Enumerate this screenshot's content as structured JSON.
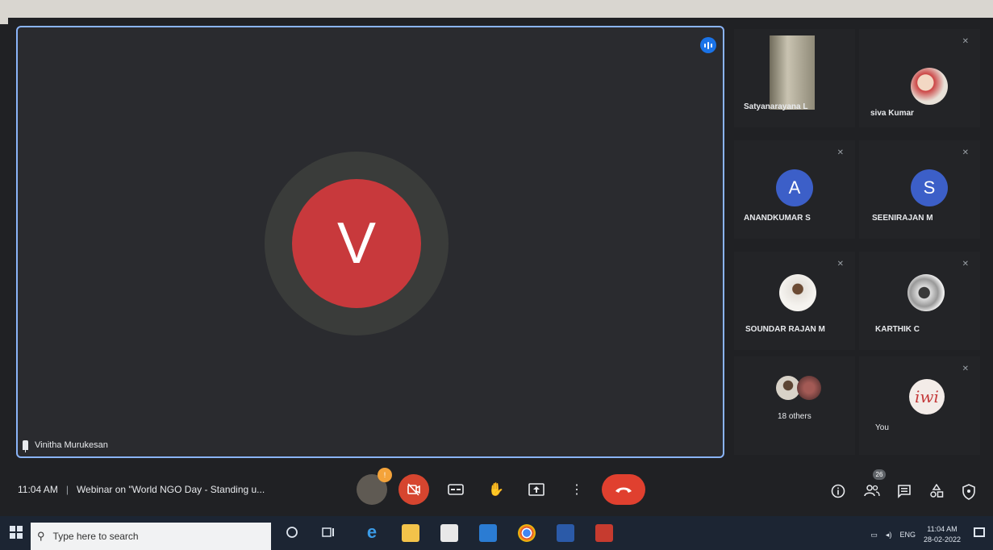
{
  "colors": {
    "accent_blue": "#8ab4f8",
    "avatar_v": "#c8393c",
    "avatar_letter": "#3c5fc8",
    "end_call": "#e0402f"
  },
  "main_speaker": {
    "initial": "V",
    "name": "Vinitha Murukesan"
  },
  "participants": [
    {
      "name": "Satyanarayana L",
      "avatar": "photo",
      "muted": false
    },
    {
      "name": "siva Kumar",
      "avatar": "photo",
      "muted": true
    },
    {
      "name": "ANANDKUMAR S",
      "avatar": "letter",
      "initial": "A",
      "muted": true
    },
    {
      "name": "SEENIRAJAN M",
      "avatar": "letter",
      "initial": "S",
      "muted": true
    },
    {
      "name": "SOUNDAR RAJAN M",
      "avatar": "photo",
      "muted": true
    },
    {
      "name": "KARTHIK C",
      "avatar": "photo",
      "muted": true
    },
    {
      "name": "18 others",
      "avatar": "group",
      "muted": false
    },
    {
      "name": "You",
      "avatar": "photo",
      "muted": true
    }
  ],
  "bottom_bar": {
    "time": "11:04 AM",
    "meeting_title": "Webinar on \"World NGO Day - Standing u...",
    "people_count": "26",
    "mic_badge": "!"
  },
  "taskbar": {
    "search_placeholder": "Type here to search",
    "lang": "ENG",
    "clock_time": "11:04 AM",
    "clock_date": "28-02-2022"
  },
  "icons": {
    "mic": "mic-icon",
    "camera_off": "camera-off-icon",
    "captions": "captions-icon",
    "raise_hand": "raise-hand-icon",
    "present": "present-icon",
    "more": "more-vert-icon",
    "end_call": "end-call-icon",
    "info": "info-icon",
    "people": "people-icon",
    "chat": "chat-icon",
    "activities": "activities-icon",
    "host_controls": "shield-icon"
  }
}
